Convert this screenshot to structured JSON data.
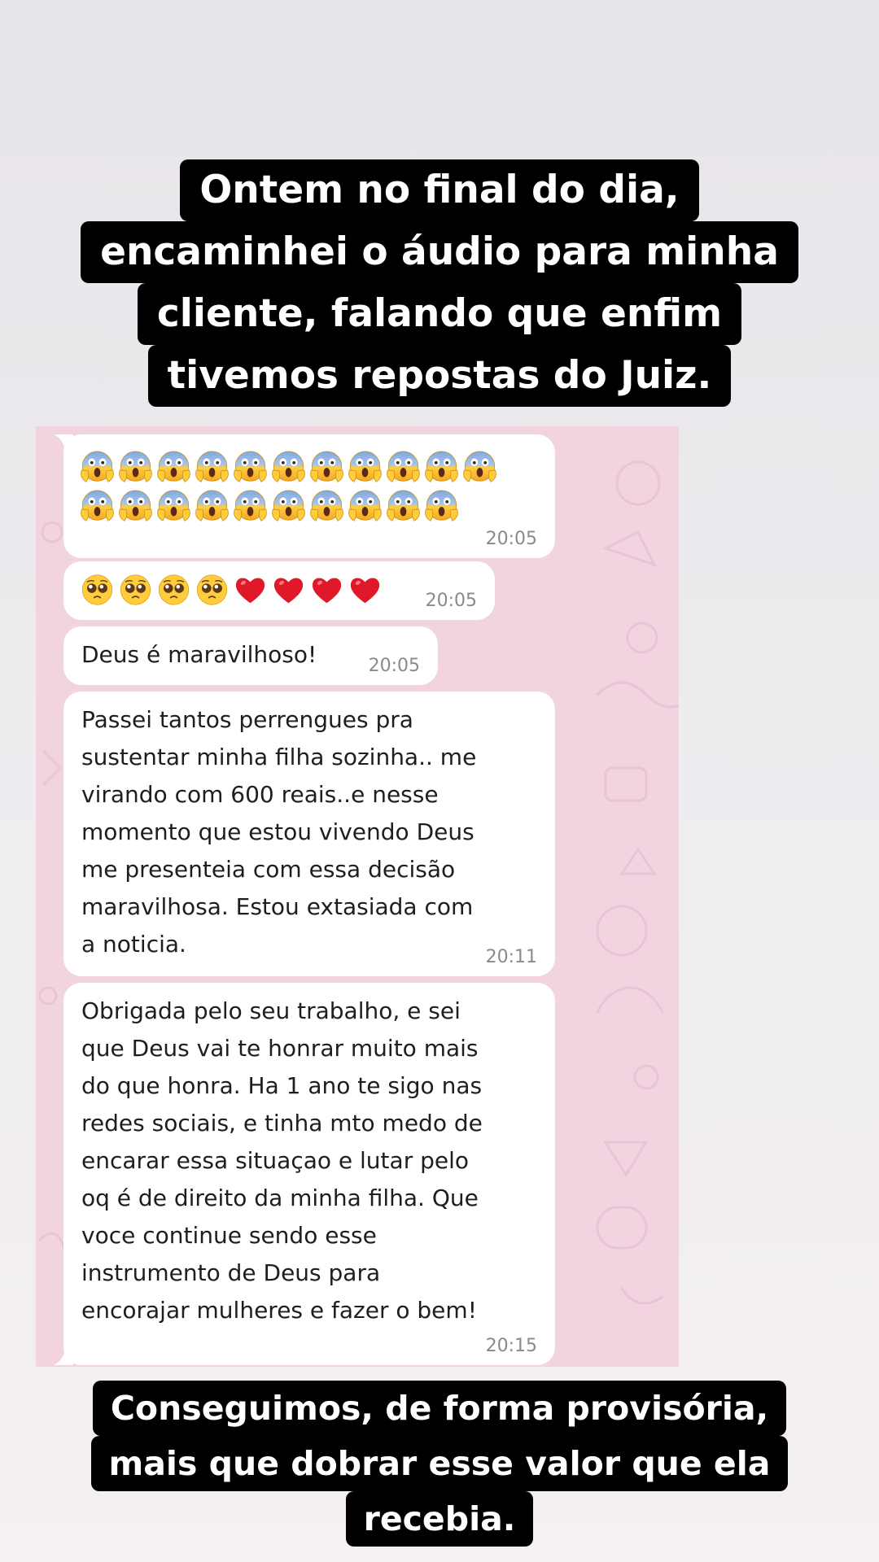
{
  "caption_top": {
    "lines": [
      "Ontem no final do dia,",
      "encaminhei o áudio para minha",
      "cliente, falando que enfim",
      "tivemos repostas do Juiz."
    ]
  },
  "caption_bottom": {
    "lines": [
      "Conseguimos, de forma provisória,",
      "mais que dobrar esse valor que ela",
      "recebia."
    ]
  },
  "chat": {
    "background_color": "#f2d3e0",
    "bubble_color": "#ffffff",
    "messages": [
      {
        "type": "emoji",
        "emoji_icons": [
          "face-screaming-in-fear-icon"
        ],
        "emoji_counts": [
          11,
          10
        ],
        "time": "20:05"
      },
      {
        "type": "emoji",
        "emoji_icons": [
          "pleading-face-icon",
          "red-heart-icon"
        ],
        "emoji_counts": [
          4,
          4
        ],
        "time": "20:05"
      },
      {
        "type": "text",
        "lines": [
          "Deus é maravilhoso!"
        ],
        "time": "20:05"
      },
      {
        "type": "text",
        "lines": [
          "Passei tantos perrengues pra",
          "sustentar minha filha sozinha.. me",
          "virando com 600 reais..e nesse",
          "momento que estou vivendo Deus",
          "me presenteia com essa decisão",
          "maravilhosa. Estou extasiada com",
          "a noticia."
        ],
        "time": "20:11"
      },
      {
        "type": "text",
        "lines": [
          "Obrigada pelo seu trabalho, e sei",
          "que Deus vai te honrar muito mais",
          "do que honra. Ha 1 ano te sigo nas",
          "redes sociais, e tinha mto medo de",
          "encarar essa situaçao e lutar pelo",
          "oq é de direito da minha filha. Que",
          "voce continue sendo esse",
          "instrumento de Deus para",
          "encorajar mulheres e fazer o bem!"
        ],
        "time": "20:15"
      }
    ]
  }
}
